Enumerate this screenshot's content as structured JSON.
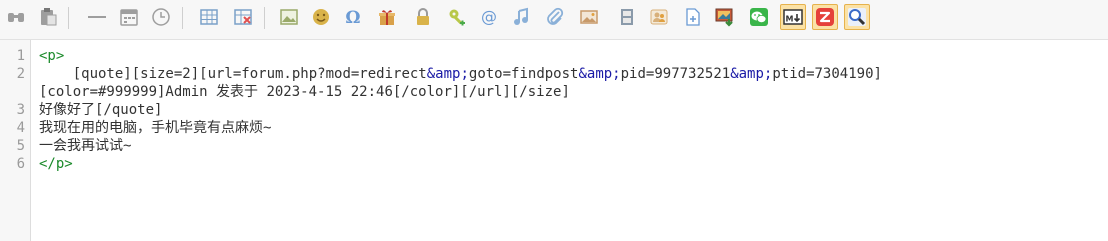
{
  "toolbar": {
    "buttons": [
      {
        "icon": "find-replace-icon",
        "color": "#9e9e9e",
        "active": false
      },
      {
        "icon": "paste-icon",
        "color": "#9e9e9e",
        "active": false
      },
      {
        "icon": "horizontal-rule-icon",
        "color": "#9e9e9e",
        "active": false
      },
      {
        "icon": "calendar-icon",
        "color": "#9e9e9e",
        "active": false
      },
      {
        "icon": "clock-icon",
        "color": "#9e9e9e",
        "active": false
      },
      {
        "icon": "table-icon",
        "color": "#7aa0c8",
        "active": false
      },
      {
        "icon": "delete-table-icon",
        "color": "#7aa0c8",
        "active": false
      },
      {
        "icon": "image-icon",
        "color": "#9aaa6a",
        "active": false
      },
      {
        "icon": "emoticon-icon",
        "color": "#d9b34a",
        "active": false
      },
      {
        "icon": "special-char-icon",
        "color": "#6a9ad4",
        "active": false
      },
      {
        "icon": "gift-icon",
        "color": "#d9a14a",
        "active": false
      },
      {
        "icon": "lock-icon",
        "color": "#d9b34a",
        "active": false
      },
      {
        "icon": "key-icon",
        "color": "#b8c84a",
        "active": false
      },
      {
        "icon": "at-mention-icon",
        "color": "#6a9ad4",
        "active": false
      },
      {
        "icon": "music-icon",
        "color": "#8ab0d8",
        "active": false
      },
      {
        "icon": "attachment-icon",
        "color": "#8ab0d8",
        "active": false
      },
      {
        "icon": "photo-icon",
        "color": "#c89a6a",
        "active": false
      },
      {
        "icon": "film-icon",
        "color": "#8a9aaa",
        "active": false
      },
      {
        "icon": "people-icon",
        "color": "#d8b07a",
        "active": false
      },
      {
        "icon": "new-page-icon",
        "color": "#6a9ad4",
        "active": false
      },
      {
        "icon": "image-download-icon",
        "color": "#3a8a3a",
        "active": false
      },
      {
        "icon": "wechat-icon",
        "color": "#3ab54a",
        "active": false
      },
      {
        "icon": "markdown-icon",
        "color": "#333333",
        "active": true
      },
      {
        "icon": "red-app-icon",
        "color": "#e5413a",
        "active": true
      },
      {
        "icon": "search-zoom-icon",
        "color": "#3a6ac8",
        "active": true
      }
    ]
  },
  "editor": {
    "line_numbers": [
      "1",
      "2",
      "3",
      "4",
      "5",
      "6"
    ],
    "lines": {
      "l1_tag": "<p>",
      "l2_text_a": "    [quote][size=2][url=forum.php?mod=redirect",
      "l2_ent_1": "&amp;",
      "l2_text_b": "goto=findpost",
      "l2_ent_2": "&amp;",
      "l2_text_c": "pid=997732521",
      "l2_ent_3": "&amp;",
      "l2_text_d": "ptid=7304190]",
      "l2_text_e": "[color=#999999]Admin ",
      "l2_cn": "发表于",
      "l2_text_f": " 2023-4-15 22:46[/color][/url][/size]",
      "l3_cn": "好像好了",
      "l3_text": "[/quote]",
      "l4_cn": "我现在用的电脑，手机毕竟有点麻烦",
      "l4_text": "~",
      "l5_cn": "一会我再试试",
      "l5_text": "~",
      "l6_tag": "</p>"
    }
  },
  "colors": {
    "tag": "#1a8a2a",
    "entity": "#1a1aa6",
    "line_number": "#9a9a9a",
    "gutter_bg": "#f7f7f7"
  }
}
